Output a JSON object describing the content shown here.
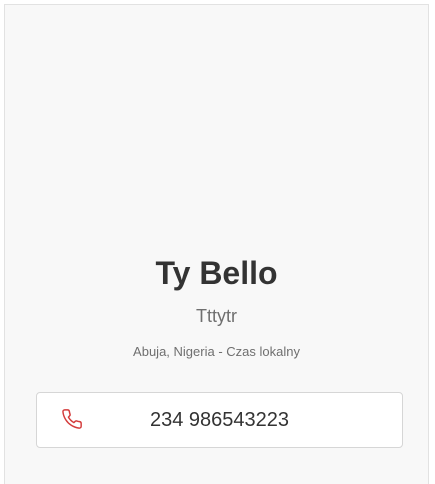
{
  "profile": {
    "name": "Ty Bello",
    "subtitle": "Tttytr",
    "location": "Abuja, Nigeria - Czas lokalny"
  },
  "contact": {
    "phone": "234 986543223",
    "icon": "phone-icon",
    "icon_color": "#d43c3c"
  }
}
